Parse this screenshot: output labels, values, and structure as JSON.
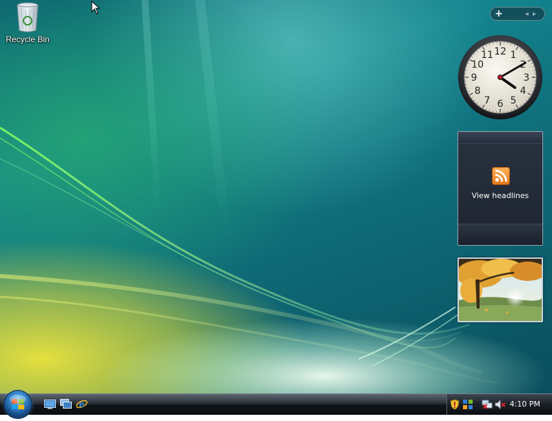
{
  "desktop": {
    "icons": [
      {
        "label": "Recycle Bin",
        "icon": "recycle-bin-icon"
      }
    ]
  },
  "sidebar": {
    "toolbar": {
      "add": "+",
      "prev": "◂",
      "next": "▸"
    },
    "clock_gadget": {
      "numerals": [
        "12",
        "1",
        "2",
        "3",
        "4",
        "5",
        "6",
        "7",
        "8",
        "9",
        "10",
        "11"
      ],
      "hour": 4,
      "minute": 10
    },
    "news_gadget": {
      "label": "View headlines",
      "icon": "rss-icon"
    },
    "slideshow_gadget": {
      "image": "autumn-tree-landscape"
    }
  },
  "taskbar": {
    "start_icon": "windows-start-orb",
    "quick_launch": [
      "show-desktop-icon",
      "switch-windows-icon",
      "internet-explorer-icon"
    ],
    "tray_icons": [
      "security-shield-icon",
      "windows-update-icon",
      "network-disconnected-icon",
      "volume-muted-icon"
    ],
    "time": "4:10 PM"
  },
  "colors": {
    "taskbar": "#1b2026",
    "rss_orange": "#f28b26",
    "clock_face": "#f2efe6"
  }
}
